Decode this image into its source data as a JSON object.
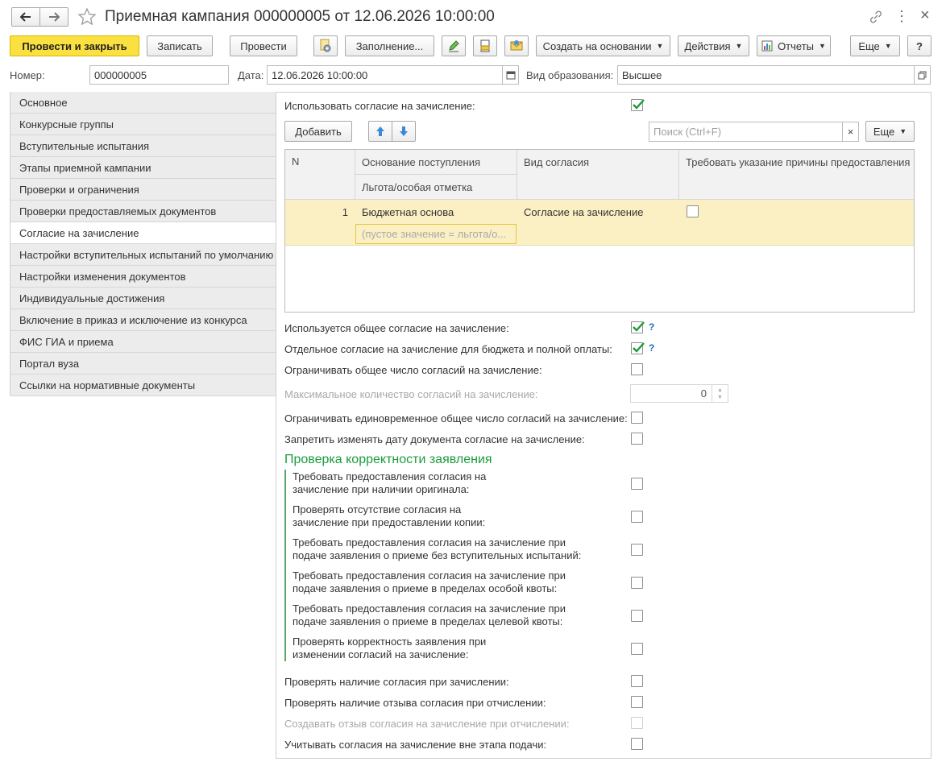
{
  "window": {
    "title": "Приемная кампания 000000005 от 12.06.2026 10:00:00",
    "controls": {
      "link": "🔗",
      "more": "⋮",
      "close": "×"
    }
  },
  "toolbar": {
    "post_close": "Провести и закрыть",
    "save": "Записать",
    "post": "Провести",
    "fill": "Заполнение...",
    "create_based": "Создать на основании",
    "actions": "Действия",
    "reports": "Отчеты",
    "more": "Еще",
    "help": "?"
  },
  "header": {
    "number_label": "Номер:",
    "number_value": "000000005",
    "date_label": "Дата:",
    "date_value": "12.06.2026 10:00:00",
    "edu_label": "Вид образования:",
    "edu_value": "Высшее"
  },
  "nav": {
    "items": [
      "Основное",
      "Конкурсные группы",
      "Вступительные испытания",
      "Этапы приемной кампании",
      "Проверки и ограничения",
      "Проверки предоставляемых документов",
      "Согласие на зачисление",
      "Настройки вступительных испытаний по умолчанию",
      "Настройки изменения документов",
      "Индивидуальные достижения",
      "Включение в приказ и исключение из конкурса",
      "ФИС ГИА и приема",
      "Портал вуза",
      "Ссылки на нормативные документы"
    ],
    "active_index": 6
  },
  "main": {
    "use_consent_label": "Использовать согласие на зачисление:",
    "use_consent_checked": true,
    "add_button": "Добавить",
    "search_placeholder": "Поиск (Ctrl+F)",
    "search_clear": "×",
    "more_button": "Еще",
    "table": {
      "headers": {
        "n": "N",
        "basis": "Основание поступления",
        "benefit": "Льгота/особая отметка",
        "consent_type": "Вид согласия",
        "require_reason": "Требовать указание причины предоставления"
      },
      "rows": [
        {
          "n": "1",
          "basis": "Бюджетная основа",
          "benefit": "(пустое значение = льгота/о...",
          "consent_type": "Согласие на зачисление",
          "require_reason": false
        }
      ]
    },
    "settings": [
      {
        "label": "Используется общее согласие на зачисление:",
        "checked": true,
        "help": "?"
      },
      {
        "label": "Отдельное согласие на зачисление для бюджета и полной оплаты:",
        "checked": true,
        "help": "?"
      },
      {
        "label": "Ограничивать общее число согласий на зачисление:",
        "checked": false
      }
    ],
    "max_count_label": "Максимальное количество согласий на зачисление:",
    "max_count_value": "0",
    "settings2": [
      {
        "label": "Ограничивать единовременное общее число согласий на зачисление:",
        "checked": false
      },
      {
        "label": "Запретить изменять дату документа согласие на зачисление:",
        "checked": false
      }
    ],
    "section_title": "Проверка корректности заявления",
    "checks": [
      {
        "label": "Требовать предоставления согласия на\nзачисление при наличии оригинала:",
        "checked": false
      },
      {
        "label": "Проверять отсутствие согласия на\nзачисление при предоставлении копии:",
        "checked": false
      },
      {
        "label": "Требовать предоставления согласия на зачисление при\nподаче заявления о приеме без вступительных испытаний:",
        "checked": false
      },
      {
        "label": "Требовать предоставления согласия на зачисление при\nподаче заявления о приеме в пределах особой квоты:",
        "checked": false
      },
      {
        "label": "Требовать предоставления согласия на зачисление при\nподаче заявления о приеме в пределах целевой квоты:",
        "checked": false
      },
      {
        "label": "Проверять корректность заявления при\nизменении согласий на зачисление:",
        "checked": false
      }
    ],
    "bottom": [
      {
        "label": "Проверять наличие согласия при зачислении:",
        "checked": false,
        "disabled": false
      },
      {
        "label": "Проверять наличие отзыва согласия при отчислении:",
        "checked": false,
        "disabled": false
      },
      {
        "label": "Создавать отзыв согласия на зачисление при отчислении:",
        "checked": false,
        "disabled": true
      },
      {
        "label": "Учитывать согласия на зачисление вне этапа подачи:",
        "checked": false,
        "disabled": false
      }
    ]
  },
  "colors": {
    "accent_yellow": "#fbe140",
    "row_highlight": "#fbf0c3",
    "check_green": "#1a9c3c",
    "section_green": "#1a9c3c",
    "help_blue": "#1d6fbf"
  }
}
